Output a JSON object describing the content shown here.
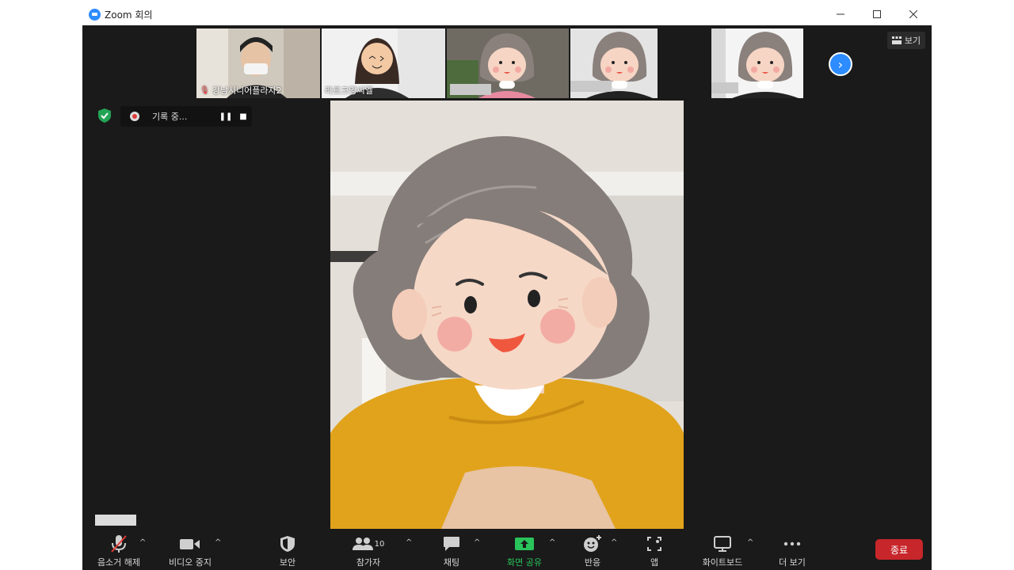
{
  "window": {
    "title": "Zoom 회의"
  },
  "gallery": {
    "tiles": [
      {
        "name": "강남시니어플라자2",
        "muted": true
      },
      {
        "name": "라르크앙씨엘"
      },
      {
        "name": ""
      },
      {
        "name": ""
      },
      {
        "name": ""
      }
    ],
    "view_label": "보기"
  },
  "recording": {
    "label": "기록 중..."
  },
  "toolbar": {
    "unmute": "음소거 해제",
    "stop_video": "비디오 중지",
    "security": "보안",
    "participants": "참가자",
    "participants_count": "10",
    "chat": "채팅",
    "share_screen": "화면 공유",
    "reactions": "반응",
    "apps": "앱",
    "whiteboard": "화이트보드",
    "more": "더 보기",
    "end": "종료"
  },
  "colors": {
    "accent": "#2d8cff",
    "share_green": "#29c45b",
    "end_red": "#c7262a"
  }
}
